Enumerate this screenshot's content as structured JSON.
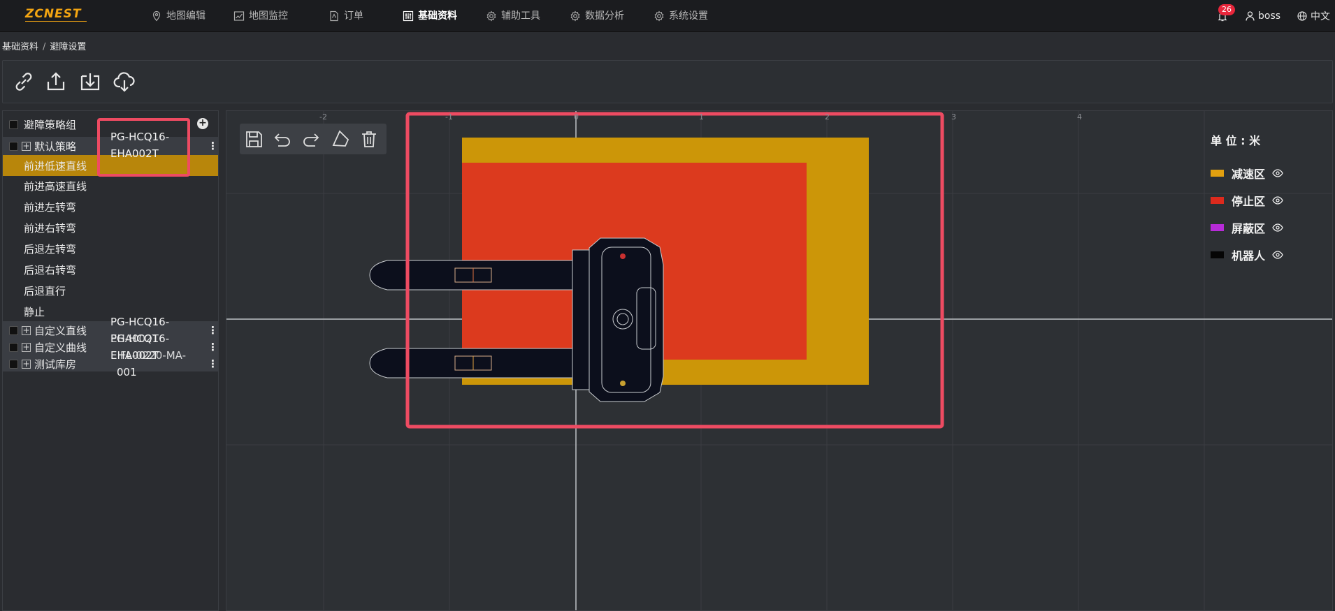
{
  "app": {
    "logo": "ZCNEST",
    "nav": [
      {
        "label": "地图编辑",
        "icon": "map-pin-icon"
      },
      {
        "label": "地图监控",
        "icon": "chart-icon"
      },
      {
        "label": "订单",
        "icon": "document-icon"
      },
      {
        "label": "基础资料",
        "icon": "sliders-icon",
        "active": true
      },
      {
        "label": "辅助工具",
        "icon": "gear-icon"
      },
      {
        "label": "数据分析",
        "icon": "gear-icon"
      },
      {
        "label": "系统设置",
        "icon": "gear-icon"
      }
    ],
    "notification_count": "26",
    "user": "boss",
    "language": "中文"
  },
  "breadcrumb": {
    "root": "基础资料",
    "separator": "/",
    "current": "避障设置"
  },
  "toolbar": {
    "buttons": [
      "link-icon",
      "upload-icon",
      "download-icon",
      "cloud-download-icon"
    ]
  },
  "tree": {
    "header": "避障策略组",
    "groups": [
      {
        "label": "默认策略",
        "tooltip": "PG-HCQ16-EHA002T"
      },
      {
        "label": "自定义直线"
      },
      {
        "label": "自定义曲线"
      },
      {
        "label": "测试库房"
      }
    ],
    "children": [
      "前进低速直线",
      "前进高速直线",
      "前进左转弯",
      "前进右转弯",
      "后退左转弯",
      "后退右转弯",
      "后退直行",
      "静止"
    ],
    "overlapping_text": {
      "line1": "PG-HCQ16-",
      "line2a": "EHA002T",
      "line2b": "PG-HCQ16-",
      "line3a": "EHA002T",
      "line3b": "FL-0220-MA-",
      "line4": "001"
    }
  },
  "canvas": {
    "tools": [
      "save-icon",
      "undo-icon",
      "redo-icon",
      "polygon-icon",
      "delete-icon"
    ],
    "axis_x_ticks": [
      "-2",
      "-1",
      "0",
      "1",
      "2",
      "3",
      "4"
    ],
    "legend_title": "单 位 : 米",
    "legend": [
      {
        "label": "减速区",
        "color": "#e2a00f"
      },
      {
        "label": "停止区",
        "color": "#dd2a1d"
      },
      {
        "label": "屏蔽区",
        "color": "#b72bd8"
      },
      {
        "label": "机器人",
        "color": "#050505"
      }
    ],
    "zones": {
      "slow_color": "#cc9608",
      "stop_color": "#dc3a1e"
    }
  }
}
